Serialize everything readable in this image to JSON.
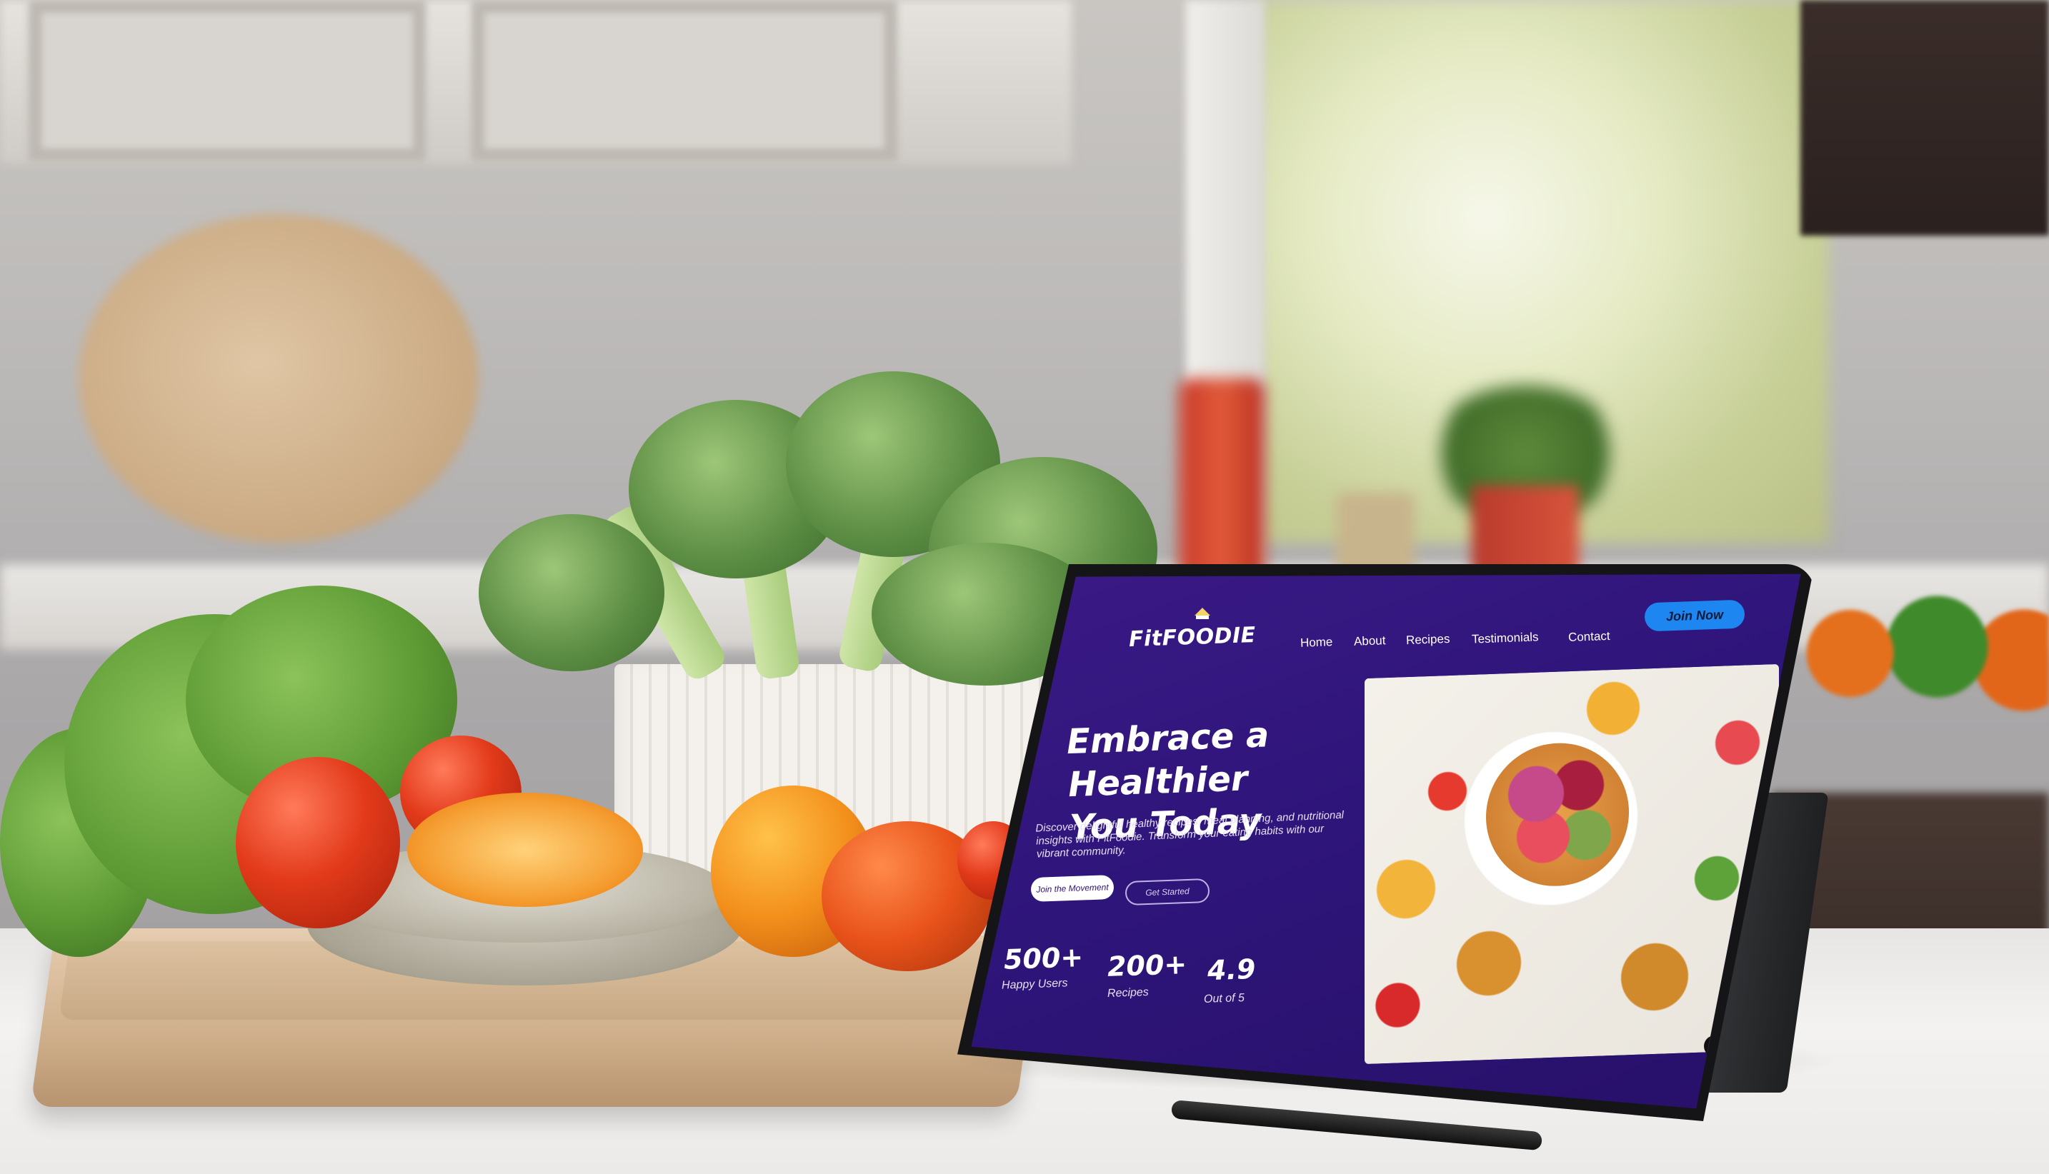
{
  "site": {
    "logo_text": "FitFOODIE",
    "nav": [
      "Home",
      "About",
      "Recipes",
      "Testimonials",
      "Contact"
    ],
    "join_now_label": "Join Now",
    "hero": {
      "title_line1": "Embrace a Healthier",
      "title_line2": "You Today",
      "description": "Discover delightful healthy recipes, meal planning, and nutritional insights with FitFoodie. Transform your eating habits with our vibrant community.",
      "primary_button": "Join the Movement",
      "secondary_button": "Get Started"
    },
    "stats": [
      {
        "value": "500+",
        "label": "Happy Users"
      },
      {
        "value": "200+",
        "label": "Recipes"
      },
      {
        "value": "4.9",
        "label": "Out of 5"
      }
    ],
    "scroll_top_icon": "arrow-up-icon"
  },
  "colors": {
    "screen_bg": "#2e157a",
    "accent_button": "#1e86f0"
  }
}
